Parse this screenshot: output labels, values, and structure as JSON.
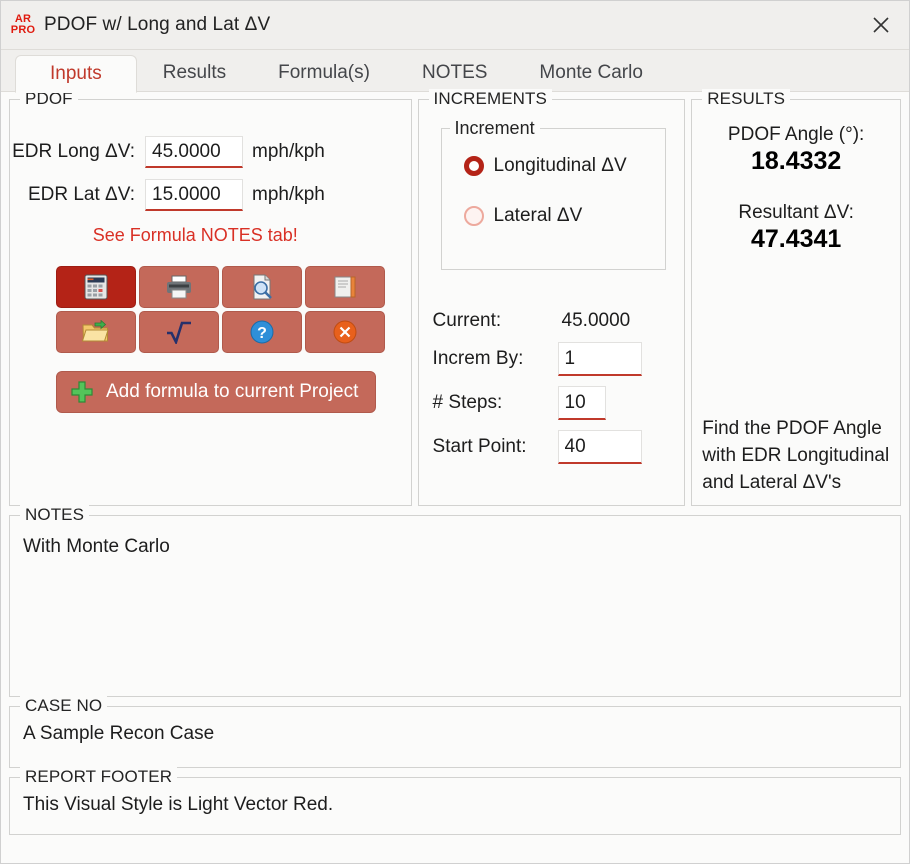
{
  "window": {
    "logo_line1": "AR",
    "logo_line2": "PRO",
    "title": "PDOF w/ Long and Lat ΔV",
    "close_label": "✕"
  },
  "tabs": [
    {
      "label": "Inputs",
      "active": true
    },
    {
      "label": "Results",
      "active": false
    },
    {
      "label": "Formula(s)",
      "active": false
    },
    {
      "label": "NOTES",
      "active": false
    },
    {
      "label": "Monte Carlo",
      "active": false
    }
  ],
  "pdof": {
    "legend": "PDOF",
    "long_label": "EDR Long ΔV:",
    "long_value": "45.0000",
    "long_unit": "mph/kph",
    "lat_label": "EDR Lat ΔV:",
    "lat_value": "15.0000",
    "lat_unit": "mph/kph",
    "notice": "See Formula NOTES tab!",
    "buttons": [
      {
        "name": "calculator-icon",
        "active": true
      },
      {
        "name": "printer-icon",
        "active": false
      },
      {
        "name": "print-preview-icon",
        "active": false
      },
      {
        "name": "book-icon",
        "active": false
      },
      {
        "name": "open-folder-icon",
        "active": false
      },
      {
        "name": "square-root-icon",
        "active": false
      },
      {
        "name": "help-icon",
        "active": false
      },
      {
        "name": "close-circle-icon",
        "active": false
      }
    ],
    "add_button_label": "Add formula to current Project"
  },
  "increments": {
    "legend": "INCREMENTS",
    "sub_legend": "Increment",
    "radio_longitudinal": "Longitudinal ΔV",
    "radio_lateral": "Lateral ΔV",
    "selected": "Longitudinal ΔV",
    "current_label": "Current:",
    "current_value": "45.0000",
    "increm_by_label": "Increm By:",
    "increm_by_value": "1",
    "steps_label": "# Steps:",
    "steps_value": "10",
    "start_point_label": "Start Point:",
    "start_point_value": "40"
  },
  "results": {
    "legend": "RESULTS",
    "angle_caption": "PDOF Angle (°):",
    "angle_value": "18.4332",
    "resultant_caption": "Resultant ΔV:",
    "resultant_value": "47.4341",
    "description": "Find the PDOF Angle with EDR Longitudinal and Lateral ΔV's"
  },
  "notes": {
    "legend": "NOTES",
    "value": "With Monte Carlo"
  },
  "case_no": {
    "legend": "CASE NO",
    "value": "A Sample Recon Case"
  },
  "report_footer": {
    "legend": "REPORT FOOTER",
    "value": "This Visual Style is Light Vector Red."
  },
  "colors": {
    "accent_red": "#b42317",
    "button_salmon": "#c4695a",
    "notice_red": "#d93025",
    "logo_red": "#e01b0f",
    "panel_bg": "#fbfbfa",
    "chrome_bg": "#f0efed"
  }
}
